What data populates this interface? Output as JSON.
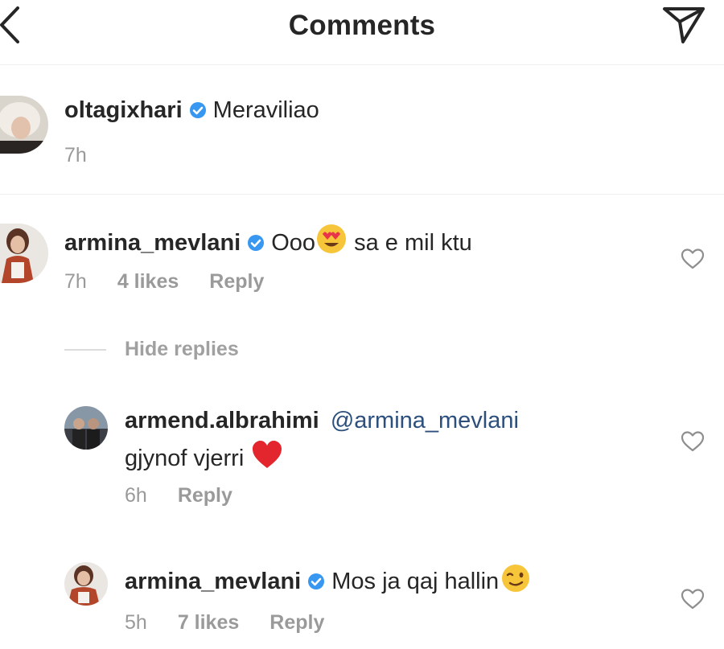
{
  "header": {
    "title": "Comments"
  },
  "caption": {
    "username": "oltagixhari",
    "text": "Meraviliao",
    "time": "7h"
  },
  "comments": [
    {
      "username": "armina_mevlani",
      "text_before": "Ooo",
      "text_after": " sa e mil ktu",
      "time": "7h",
      "likes": "4 likes",
      "reply": "Reply",
      "hide_replies": "Hide replies"
    },
    {
      "username": "armend.albrahimi",
      "mention": "@armina_mevlani",
      "text": "gjynof vjerri",
      "time": "6h",
      "reply": "Reply"
    },
    {
      "username": "armina_mevlani",
      "text": "Mos ja qaj hallin",
      "time": "5h",
      "likes": "7 likes",
      "reply": "Reply"
    }
  ],
  "icons": {
    "back": "chevron-left-icon",
    "send": "paper-plane-icon",
    "verified": "verified-badge-icon",
    "like": "heart-outline-icon"
  },
  "colors": {
    "verified": "#3897f0",
    "mention": "#2c4f7c",
    "muted": "#9a9a9a"
  }
}
